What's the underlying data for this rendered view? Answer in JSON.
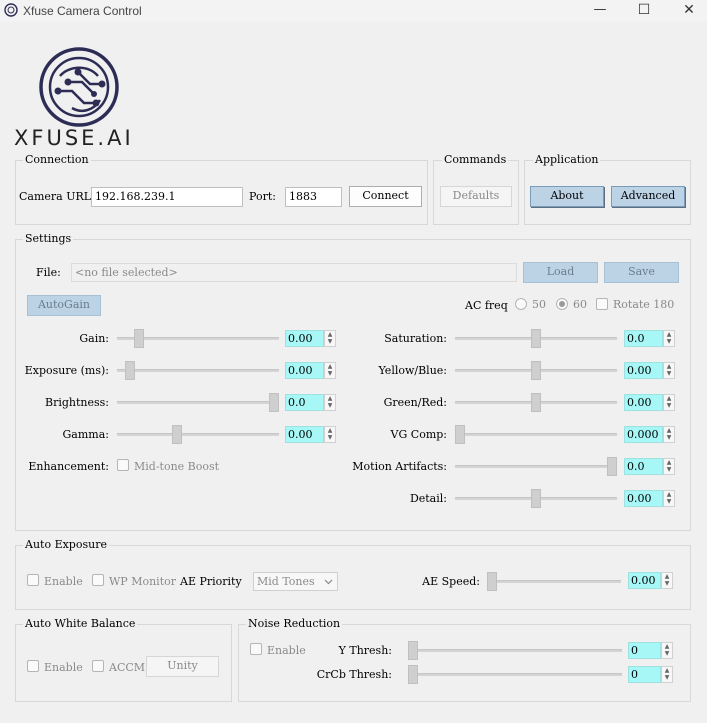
{
  "window": {
    "title": "Xfuse Camera Control",
    "minimize": "—",
    "maximize": "☐",
    "close": "✕"
  },
  "logo": {
    "text": "XFUSE.AI",
    "brand_color": "#2d2c55"
  },
  "connection": {
    "title": "Connection",
    "url_label": "Camera URL:",
    "url_value": "192.168.239.1",
    "port_label": "Port:",
    "port_value": "1883",
    "connect_label": "Connect"
  },
  "commands": {
    "title": "Commands",
    "defaults_label": "Defaults"
  },
  "application": {
    "title": "Application",
    "about_label": "About",
    "advanced_label": "Advanced"
  },
  "settings": {
    "title": "Settings",
    "file_label": "File:",
    "file_placeholder": "<no file selected>",
    "load_label": "Load",
    "save_label": "Save",
    "autogain_label": "AutoGain",
    "acfreq_label": "AC freq",
    "acfreq_50": "50",
    "acfreq_60": "60",
    "acfreq_selected": "60",
    "rotate_label": "Rotate 180",
    "enhancement_label": "Enhancement:",
    "midtone_label": "Mid-tone Boost",
    "left_sliders": [
      {
        "label": "Gain:",
        "value": "0.00",
        "level": 0.11
      },
      {
        "label": "Exposure (ms):",
        "value": "0.00",
        "level": 0.05
      },
      {
        "label": "Brightness:",
        "value": "0.0",
        "level": 1.0
      },
      {
        "label": "Gamma:",
        "value": "0.00",
        "level": 0.36
      }
    ],
    "right_sliders": [
      {
        "label": "Saturation:",
        "value": "0.0",
        "level": 0.5
      },
      {
        "label": "Yellow/Blue:",
        "value": "0.00",
        "level": 0.5
      },
      {
        "label": "Green/Red:",
        "value": "0.00",
        "level": 0.5
      },
      {
        "label": "VG Comp:",
        "value": "0.000",
        "level": 0.0
      },
      {
        "label": "Motion Artifacts:",
        "value": "0.0",
        "level": 1.0
      },
      {
        "label": "Detail:",
        "value": "0.00",
        "level": 0.5
      }
    ]
  },
  "auto_exposure": {
    "title": "Auto Exposure",
    "enable_label": "Enable",
    "wp_monitor_label": "WP Monitor",
    "priority_label": "AE Priority",
    "priority_value": "Mid Tones",
    "speed_label": "AE Speed:",
    "speed_value": "0.00",
    "speed_level": 0.0
  },
  "auto_white_balance": {
    "title": "Auto White Balance",
    "enable_label": "Enable",
    "accm_label": "ACCM",
    "unity_label": "Unity"
  },
  "noise_reduction": {
    "title": "Noise Reduction",
    "enable_label": "Enable",
    "ythresh_label": "Y Thresh:",
    "ythresh_value": "0",
    "ythresh_level": 0.0,
    "crcb_label": "CrCb Thresh:",
    "crcb_value": "0",
    "crcb_level": 0.0
  },
  "colors": {
    "spin_bg": "#a8f7f7",
    "button_blue": "#bcd3e6",
    "logo_navy": "#2d2c55"
  }
}
